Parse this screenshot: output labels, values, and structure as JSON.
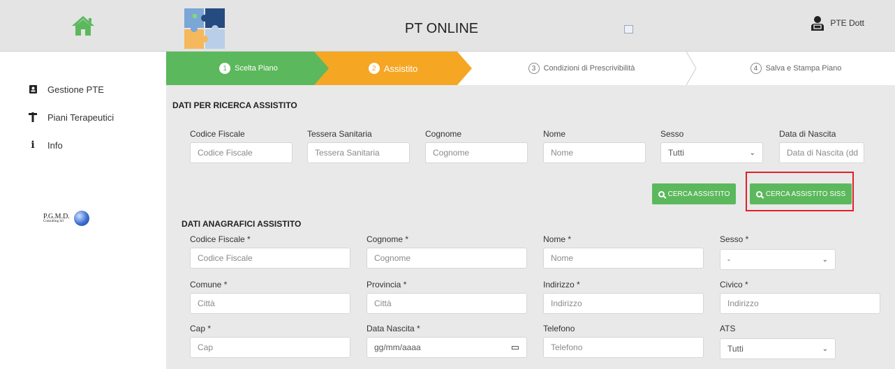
{
  "header": {
    "app_title": "PT ONLINE",
    "user_name": "PTE Dott"
  },
  "sidebar": {
    "items": [
      {
        "label": "Gestione PTE",
        "icon": "contact-book-icon"
      },
      {
        "label": "Piani Terapeutici",
        "icon": "pharmacy-icon"
      },
      {
        "label": "Info",
        "icon": "info-icon"
      }
    ],
    "logo": {
      "name": "P.G.M.D.",
      "sub": "Consulting Srl"
    }
  },
  "steps": [
    {
      "num": "1",
      "label": "Scelta Piano"
    },
    {
      "num": "2",
      "label": "Assistito"
    },
    {
      "num": "3",
      "label": "Condizioni di Prescrivibilità"
    },
    {
      "num": "4",
      "label": "Salva e Stampa Piano"
    }
  ],
  "search": {
    "title": "DATI PER RICERCA ASSISTITO",
    "fields": [
      {
        "label": "Codice Fiscale",
        "placeholder": "Codice Fiscale"
      },
      {
        "label": "Tessera Sanitaria",
        "placeholder": "Tessera Sanitaria"
      },
      {
        "label": "Cognome",
        "placeholder": "Cognome"
      },
      {
        "label": "Nome",
        "placeholder": "Nome"
      },
      {
        "label": "Sesso",
        "value": "Tutti"
      },
      {
        "label": "Data di Nascita",
        "placeholder": "Data di Nascita (dd"
      }
    ],
    "btn_search": "CERCA ASSISTITO",
    "btn_search_siss": "CERCA ASSISTITO SISS"
  },
  "anagrafica": {
    "title": "DATI ANAGRAFICI ASSISTITO",
    "row1": [
      {
        "label": "Codice Fiscale *",
        "placeholder": "Codice Fiscale"
      },
      {
        "label": "Cognome *",
        "placeholder": "Cognome"
      },
      {
        "label": "Nome *",
        "placeholder": "Nome"
      },
      {
        "label": "Sesso *",
        "value": "-"
      }
    ],
    "row2": [
      {
        "label": "Comune *",
        "placeholder": "Città"
      },
      {
        "label": "Provincia *",
        "placeholder": "Città"
      },
      {
        "label": "Indirizzo *",
        "placeholder": "Indirizzo"
      },
      {
        "label": "Civico *",
        "placeholder": "Indirizzo"
      }
    ],
    "row3": [
      {
        "label": "Cap *",
        "placeholder": "Cap"
      },
      {
        "label": "Data Nascita *",
        "placeholder": "gg/mm/aaaa"
      },
      {
        "label": "Telefono",
        "placeholder": "Telefono"
      },
      {
        "label": "ATS",
        "value": "Tutti"
      }
    ]
  },
  "colors": {
    "green": "#5cb85c",
    "orange": "#f5a623",
    "highlight": "#e0202a"
  }
}
